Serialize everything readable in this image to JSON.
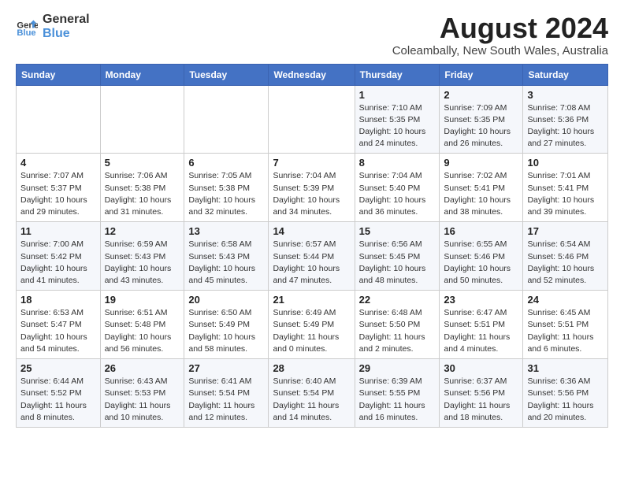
{
  "header": {
    "logo_line1": "General",
    "logo_line2": "Blue",
    "month_year": "August 2024",
    "location": "Coleambally, New South Wales, Australia"
  },
  "weekdays": [
    "Sunday",
    "Monday",
    "Tuesday",
    "Wednesday",
    "Thursday",
    "Friday",
    "Saturday"
  ],
  "weeks": [
    [
      {
        "day": "",
        "info": ""
      },
      {
        "day": "",
        "info": ""
      },
      {
        "day": "",
        "info": ""
      },
      {
        "day": "",
        "info": ""
      },
      {
        "day": "1",
        "info": "Sunrise: 7:10 AM\nSunset: 5:35 PM\nDaylight: 10 hours\nand 24 minutes."
      },
      {
        "day": "2",
        "info": "Sunrise: 7:09 AM\nSunset: 5:35 PM\nDaylight: 10 hours\nand 26 minutes."
      },
      {
        "day": "3",
        "info": "Sunrise: 7:08 AM\nSunset: 5:36 PM\nDaylight: 10 hours\nand 27 minutes."
      }
    ],
    [
      {
        "day": "4",
        "info": "Sunrise: 7:07 AM\nSunset: 5:37 PM\nDaylight: 10 hours\nand 29 minutes."
      },
      {
        "day": "5",
        "info": "Sunrise: 7:06 AM\nSunset: 5:38 PM\nDaylight: 10 hours\nand 31 minutes."
      },
      {
        "day": "6",
        "info": "Sunrise: 7:05 AM\nSunset: 5:38 PM\nDaylight: 10 hours\nand 32 minutes."
      },
      {
        "day": "7",
        "info": "Sunrise: 7:04 AM\nSunset: 5:39 PM\nDaylight: 10 hours\nand 34 minutes."
      },
      {
        "day": "8",
        "info": "Sunrise: 7:04 AM\nSunset: 5:40 PM\nDaylight: 10 hours\nand 36 minutes."
      },
      {
        "day": "9",
        "info": "Sunrise: 7:02 AM\nSunset: 5:41 PM\nDaylight: 10 hours\nand 38 minutes."
      },
      {
        "day": "10",
        "info": "Sunrise: 7:01 AM\nSunset: 5:41 PM\nDaylight: 10 hours\nand 39 minutes."
      }
    ],
    [
      {
        "day": "11",
        "info": "Sunrise: 7:00 AM\nSunset: 5:42 PM\nDaylight: 10 hours\nand 41 minutes."
      },
      {
        "day": "12",
        "info": "Sunrise: 6:59 AM\nSunset: 5:43 PM\nDaylight: 10 hours\nand 43 minutes."
      },
      {
        "day": "13",
        "info": "Sunrise: 6:58 AM\nSunset: 5:43 PM\nDaylight: 10 hours\nand 45 minutes."
      },
      {
        "day": "14",
        "info": "Sunrise: 6:57 AM\nSunset: 5:44 PM\nDaylight: 10 hours\nand 47 minutes."
      },
      {
        "day": "15",
        "info": "Sunrise: 6:56 AM\nSunset: 5:45 PM\nDaylight: 10 hours\nand 48 minutes."
      },
      {
        "day": "16",
        "info": "Sunrise: 6:55 AM\nSunset: 5:46 PM\nDaylight: 10 hours\nand 50 minutes."
      },
      {
        "day": "17",
        "info": "Sunrise: 6:54 AM\nSunset: 5:46 PM\nDaylight: 10 hours\nand 52 minutes."
      }
    ],
    [
      {
        "day": "18",
        "info": "Sunrise: 6:53 AM\nSunset: 5:47 PM\nDaylight: 10 hours\nand 54 minutes."
      },
      {
        "day": "19",
        "info": "Sunrise: 6:51 AM\nSunset: 5:48 PM\nDaylight: 10 hours\nand 56 minutes."
      },
      {
        "day": "20",
        "info": "Sunrise: 6:50 AM\nSunset: 5:49 PM\nDaylight: 10 hours\nand 58 minutes."
      },
      {
        "day": "21",
        "info": "Sunrise: 6:49 AM\nSunset: 5:49 PM\nDaylight: 11 hours\nand 0 minutes."
      },
      {
        "day": "22",
        "info": "Sunrise: 6:48 AM\nSunset: 5:50 PM\nDaylight: 11 hours\nand 2 minutes."
      },
      {
        "day": "23",
        "info": "Sunrise: 6:47 AM\nSunset: 5:51 PM\nDaylight: 11 hours\nand 4 minutes."
      },
      {
        "day": "24",
        "info": "Sunrise: 6:45 AM\nSunset: 5:51 PM\nDaylight: 11 hours\nand 6 minutes."
      }
    ],
    [
      {
        "day": "25",
        "info": "Sunrise: 6:44 AM\nSunset: 5:52 PM\nDaylight: 11 hours\nand 8 minutes."
      },
      {
        "day": "26",
        "info": "Sunrise: 6:43 AM\nSunset: 5:53 PM\nDaylight: 11 hours\nand 10 minutes."
      },
      {
        "day": "27",
        "info": "Sunrise: 6:41 AM\nSunset: 5:54 PM\nDaylight: 11 hours\nand 12 minutes."
      },
      {
        "day": "28",
        "info": "Sunrise: 6:40 AM\nSunset: 5:54 PM\nDaylight: 11 hours\nand 14 minutes."
      },
      {
        "day": "29",
        "info": "Sunrise: 6:39 AM\nSunset: 5:55 PM\nDaylight: 11 hours\nand 16 minutes."
      },
      {
        "day": "30",
        "info": "Sunrise: 6:37 AM\nSunset: 5:56 PM\nDaylight: 11 hours\nand 18 minutes."
      },
      {
        "day": "31",
        "info": "Sunrise: 6:36 AM\nSunset: 5:56 PM\nDaylight: 11 hours\nand 20 minutes."
      }
    ]
  ]
}
